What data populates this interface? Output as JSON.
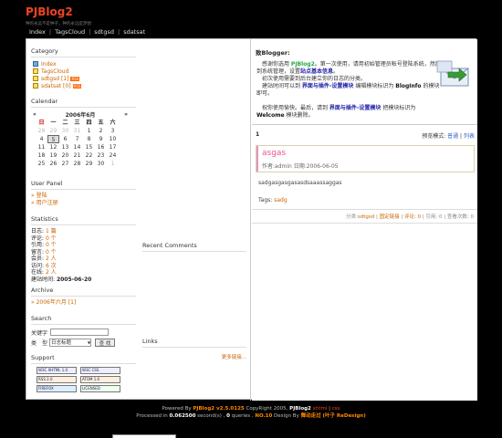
{
  "header": {
    "logo": "PJBlog2",
    "slogan": "种的永远不是种子，种的永远是梦想",
    "nav": [
      "Index",
      "TagsCloud",
      "sdtgsd",
      "sdatsat"
    ]
  },
  "category": {
    "title": "Category",
    "items": [
      {
        "label": "Index",
        "count": ""
      },
      {
        "label": "TagsCloud",
        "count": ""
      },
      {
        "label": "sdtgsd",
        "count": "[1]"
      },
      {
        "label": "sdatsat",
        "count": "[0]"
      }
    ],
    "rss": "RSS"
  },
  "calendar": {
    "title": "Calendar",
    "prev": "«",
    "next": "»",
    "month": "2006年6月",
    "weekdays": [
      "日",
      "一",
      "二",
      "三",
      "四",
      "五",
      "六"
    ],
    "days": [
      "28",
      "29",
      "30",
      "31",
      "1",
      "2",
      "3",
      "4",
      "5",
      "6",
      "7",
      "8",
      "9",
      "10",
      "11",
      "12",
      "13",
      "14",
      "15",
      "16",
      "17",
      "18",
      "19",
      "20",
      "21",
      "22",
      "23",
      "24",
      "25",
      "26",
      "27",
      "28",
      "29",
      "30",
      "1"
    ],
    "today": "5"
  },
  "user_panel": {
    "title": "User Panel",
    "links": [
      "登陆",
      "用户注册"
    ]
  },
  "statistics": {
    "title": "Statistics",
    "rows": [
      {
        "label": "日志: ",
        "value": "1 篇"
      },
      {
        "label": "评论: ",
        "value": "0 个"
      },
      {
        "label": "引用: ",
        "value": "0 个"
      },
      {
        "label": "留言: ",
        "value": "0 个"
      },
      {
        "label": "会员: ",
        "value": "2 人"
      },
      {
        "label": "访问: ",
        "value": "6 次"
      },
      {
        "label": "在线: ",
        "value": "2 人"
      },
      {
        "label": "建站时间: ",
        "value": "2005-06-20"
      }
    ]
  },
  "archive": {
    "title": "Archive",
    "items": [
      "2006年六月 [1]"
    ]
  },
  "search": {
    "title": "Search",
    "keyword_label": "关键字",
    "type_label": "类　型",
    "select_value": "日志标题",
    "button": "查 找"
  },
  "support": {
    "title": "Support",
    "badges": [
      "W3C XHTML 1.0",
      "W3C CSS",
      "RSS 2.0",
      "ATOM 1.0",
      "FIREFOX",
      "LICENSED"
    ]
  },
  "recent_comments": {
    "title": "Recent Comments"
  },
  "links": {
    "title": "Links",
    "more": "更多链接..."
  },
  "main": {
    "title": "致Blogger:",
    "notice": {
      "p1_a": "感谢你选用 ",
      "p1_b": "PJBlog2",
      "p1_c": "。第一次使用，请用初始管理员帐号登陆系统，然后到系统管理，设置",
      "p1_d": "站点基本信息",
      "p1_e": "。",
      "p2": "　初次使用需要到后台建立你的日志的分类。",
      "p3_a": "　建站时间可以到 ",
      "p3_b": "界面与插件-设置模块",
      "p3_c": " 编辑模块标识为 ",
      "p3_d": "BlogInfo",
      "p3_e": " 的模块即可。",
      "p4_a": "　祝你使用愉快。最后，请到 ",
      "p4_b": "界面与插件-设置模块",
      "p4_c": " 把模块标识为 ",
      "p4_d": "Welcome",
      "p4_e": " 模块删除。"
    },
    "page_num": "1",
    "view_mode_label": "预览模式: ",
    "view_mode_normal": "普通",
    "view_mode_list": "列表",
    "post": {
      "title": "asgas",
      "meta": "作者:admin 日期:2006-06-05",
      "body": "sadgasgasgasasdsaaassaggas",
      "tags_label": "Tags: ",
      "tag": "sadg",
      "foot_cat_label": "分类:",
      "foot_cat": "sdtgsd",
      "foot_permalink": "固定链接",
      "foot_comments": "评论: 0",
      "foot_trackback": "引用: 0",
      "foot_views": "查看次数: 0"
    }
  },
  "footer": {
    "line1_a": "Powered By ",
    "line1_b": "PJBlog2 v2.5.0125",
    "line1_c": " CopyRight 2005, ",
    "line1_d": "PJBlog2",
    "line1_e": " xhtml",
    "line1_f": " | ",
    "line1_g": "css",
    "line2_a": "Processed in ",
    "line2_b": "0.062500",
    "line2_c": " second(s) , ",
    "line2_d": "0",
    "line2_e": " queries , ",
    "line2_f": "NO.10",
    "line2_g": " Design By ",
    "line2_h": "舞动走过 (叶子 ReDesign)"
  }
}
